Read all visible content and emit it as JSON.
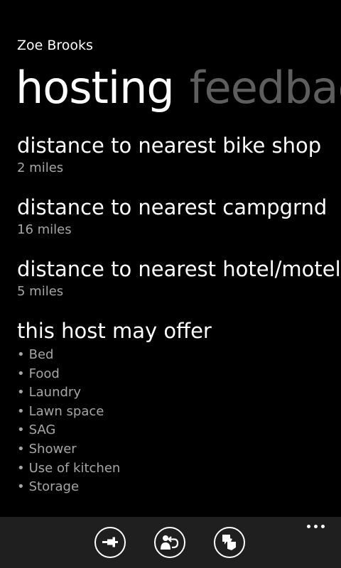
{
  "app": {
    "title": "Zoe Brooks"
  },
  "pivot": {
    "headers": [
      "hosting",
      "feedback"
    ]
  },
  "hosting": {
    "bike_shop": {
      "label": "distance to nearest bike shop",
      "value": "2 miles"
    },
    "campground": {
      "label": "distance to nearest campgrnd",
      "value": "16 miles"
    },
    "hotel": {
      "label": "distance to nearest hotel/motel",
      "value": "5 miles"
    },
    "offers": {
      "label": "this host may offer",
      "bullet": "•",
      "items": [
        "Bed",
        "Food",
        "Laundry",
        "Lawn space",
        "SAG",
        "Shower",
        "Use of kitchen",
        "Storage"
      ]
    }
  },
  "appbar": {
    "buttons": [
      {
        "icon": "pin-icon"
      },
      {
        "icon": "contact-reply-icon"
      },
      {
        "icon": "feedback-icon"
      }
    ],
    "more_icon": "ellipsis-icon"
  }
}
